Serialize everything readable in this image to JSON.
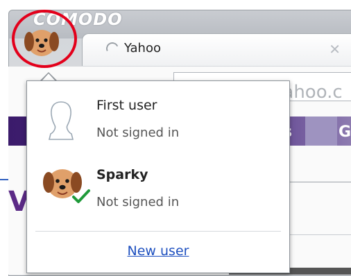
{
  "browser": {
    "brand": "COMODO",
    "tab": {
      "title": "Yahoo"
    },
    "address_text": "yahoo.c",
    "nav_letters": [
      "s",
      "G"
    ]
  },
  "profile_menu": {
    "users": [
      {
        "name": "First user",
        "status": "Not signed in",
        "avatar": "silhouette-icon",
        "active": false
      },
      {
        "name": "Sparky",
        "status": "Not signed in",
        "avatar": "dog-avatar-icon",
        "active": true
      }
    ],
    "new_user_label": "New user"
  },
  "colors": {
    "highlight_ring": "#e3001b",
    "link": "#1d4fbf",
    "check": "#1f9a3a",
    "nav_purple": "#3b1b6b"
  }
}
